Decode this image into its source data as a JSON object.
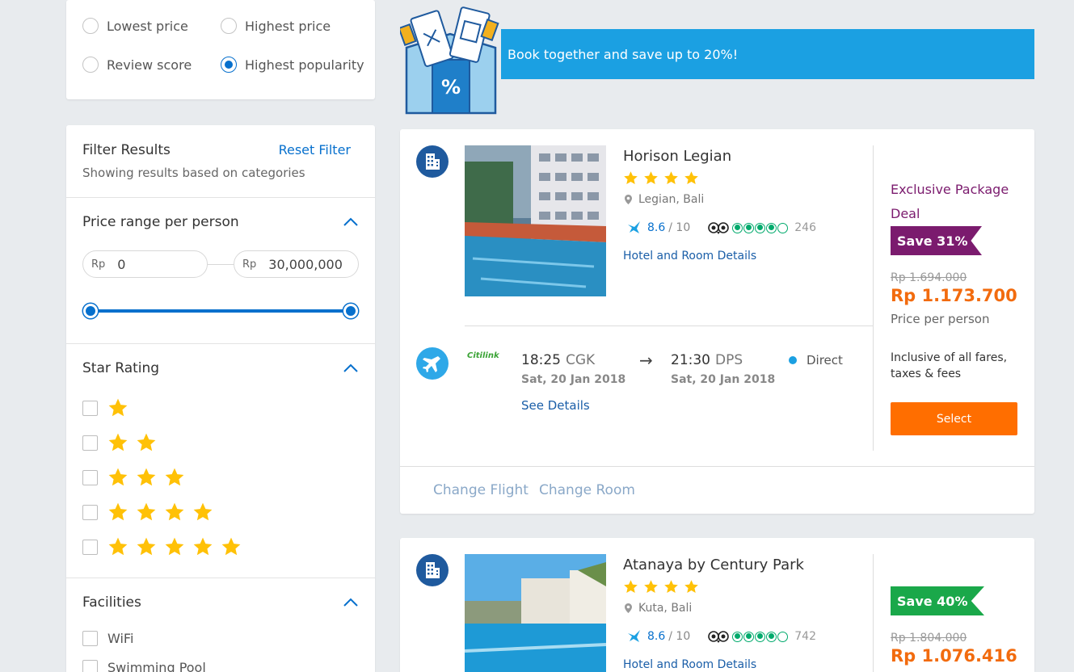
{
  "sort": {
    "options": [
      {
        "label": "Lowest price",
        "selected": false
      },
      {
        "label": "Highest price",
        "selected": false
      },
      {
        "label": "Review score",
        "selected": false
      },
      {
        "label": "Highest popularity",
        "selected": true
      }
    ]
  },
  "filter": {
    "title": "Filter Results",
    "reset_label": "Reset Filter",
    "subtitle": "Showing results based on categories",
    "price": {
      "title": "Price range per person",
      "currency": "Rp",
      "min_value": "0",
      "max_value": "30,000,000"
    },
    "star_rating": {
      "title": "Star Rating",
      "levels": [
        1,
        2,
        3,
        4,
        5
      ]
    },
    "facilities": {
      "title": "Facilities",
      "items": [
        "WiFi",
        "Swimming Pool"
      ]
    }
  },
  "banner": {
    "text": "Book together and save up to 20%!"
  },
  "results": [
    {
      "hotel_name": "Horison Legian",
      "stars": 4,
      "location": "Legian, Bali",
      "rating": "8.6",
      "rating_max": "/ 10",
      "ta_reviews": "246",
      "details_link": "Hotel and Room Details",
      "deal_label": "Exclusive Package Deal",
      "save_label": "Save 31%",
      "old_price": "Rp 1.694.000",
      "new_price": "Rp 1.173.700",
      "per_person": "Price per person",
      "inclusive": "Inclusive of all fares, taxes & fees",
      "select_label": "Select",
      "flight": {
        "airline": "Citilink",
        "dep_time": "18:25",
        "dep_code": "CGK",
        "dep_date": "Sat, 20 Jan 2018",
        "arrow": "→",
        "arr_time": "21:30",
        "arr_code": "DPS",
        "arr_date": "Sat, 20 Jan 2018",
        "stops": "Direct",
        "see_details": "See Details"
      },
      "change_flight": "Change Flight",
      "change_room": "Change Room"
    },
    {
      "hotel_name": "Atanaya by Century Park",
      "stars": 4,
      "location": "Kuta, Bali",
      "rating": "8.6",
      "rating_max": "/ 10",
      "ta_reviews": "742",
      "details_link": "Hotel and Room Details",
      "save_label": "Save 40%",
      "old_price": "Rp 1.804.000",
      "new_price": "Rp 1.076.416"
    }
  ],
  "colors": {
    "primary_blue": "#0770cd",
    "banner_blue": "#1ba0e2",
    "price_orange": "#f26b0e",
    "select_orange": "#ff6e00",
    "deal_purple": "#7b1b6e",
    "save_green": "#1aa84a",
    "star_yellow": "#ffc107",
    "tripadvisor_green": "#00aa6c"
  }
}
